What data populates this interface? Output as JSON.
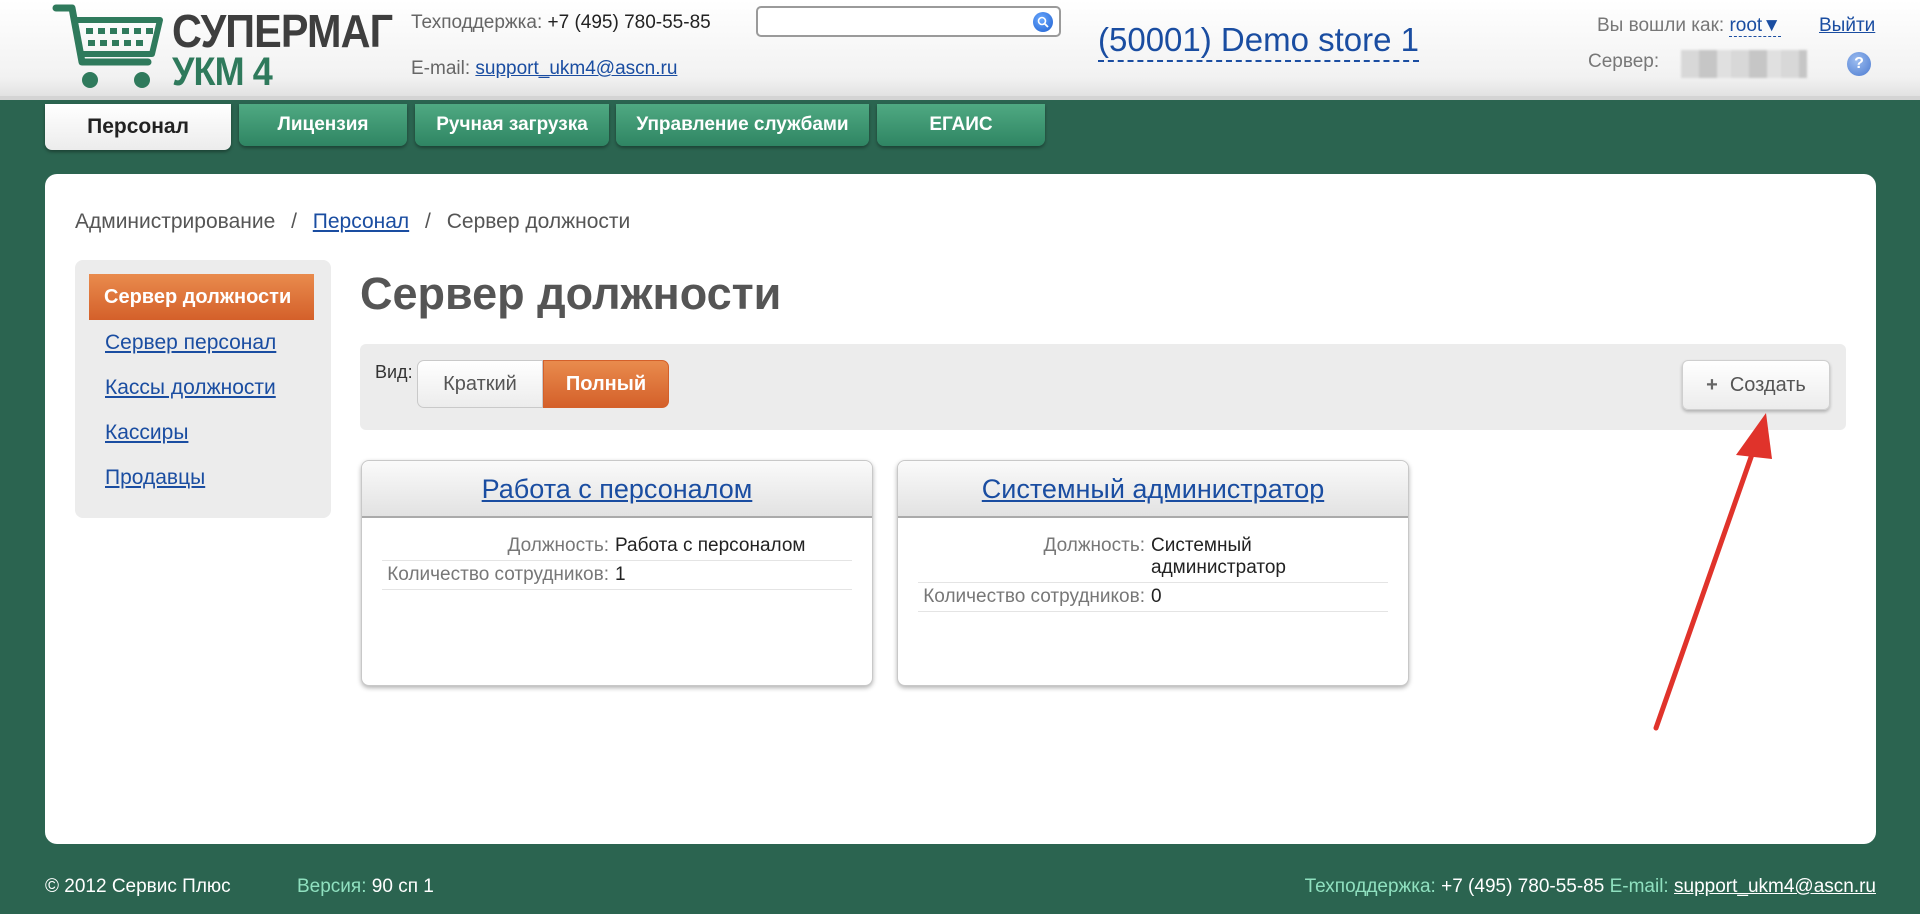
{
  "header": {
    "logo_line1": "СУПЕРМАГ",
    "logo_line2": "УКМ 4",
    "support_label": "Техподдержка:",
    "support_phone": "+7 (495) 780-55-85",
    "email_label": "E-mail:",
    "email": "support_ukm4@ascn.ru",
    "search_value": "",
    "store": "(50001) Demo store 1",
    "logged_in_label": "Вы вошли как:",
    "user": "root▼",
    "logout": "Выйти",
    "server_label": "Сервер:",
    "help": "?"
  },
  "tabs": [
    {
      "label": "Персонал",
      "active": true
    },
    {
      "label": "Лицензия"
    },
    {
      "label": "Ручная загрузка"
    },
    {
      "label": "Управление службами"
    },
    {
      "label": "ЕГАИС"
    }
  ],
  "breadcrumb": {
    "root": "Администрирование",
    "sep": "/",
    "link": "Персонал",
    "current": "Сервер должности"
  },
  "sidenav": {
    "active": "Сервер должности",
    "items": [
      "Сервер персонал",
      "Кассы должности",
      "Кассиры",
      "Продавцы"
    ]
  },
  "page_title": "Сервер должности",
  "toolbar": {
    "view_label": "Вид:",
    "view_short": "Краткий",
    "view_full": "Полный",
    "create": "Создать",
    "create_icon": "+"
  },
  "cards": [
    {
      "title": "Работа с персоналом",
      "position_label": "Должность:",
      "position_value": "Работа с персоналом",
      "count_label": "Количество сотрудников:",
      "count_value": "1"
    },
    {
      "title": "Системный администратор",
      "position_label": "Должность:",
      "position_value_line1": "Системный",
      "position_value_line2": "администратор",
      "count_label": "Количество сотрудников:",
      "count_value": "0"
    }
  ],
  "footer": {
    "copyright": "© 2012 Сервис Плюс",
    "version_label": "Версия:",
    "version": "90 сп 1",
    "support_label": "Техподдержка:",
    "support_phone": "+7 (495) 780-55-85",
    "email_label": "E-mail:",
    "email": "support_ukm4@ascn.ru"
  },
  "colors": {
    "brand_green": "#2b6450",
    "accent_orange": "#d4602a",
    "link_blue": "#1a4da1",
    "arrow_red": "#e0332b"
  }
}
